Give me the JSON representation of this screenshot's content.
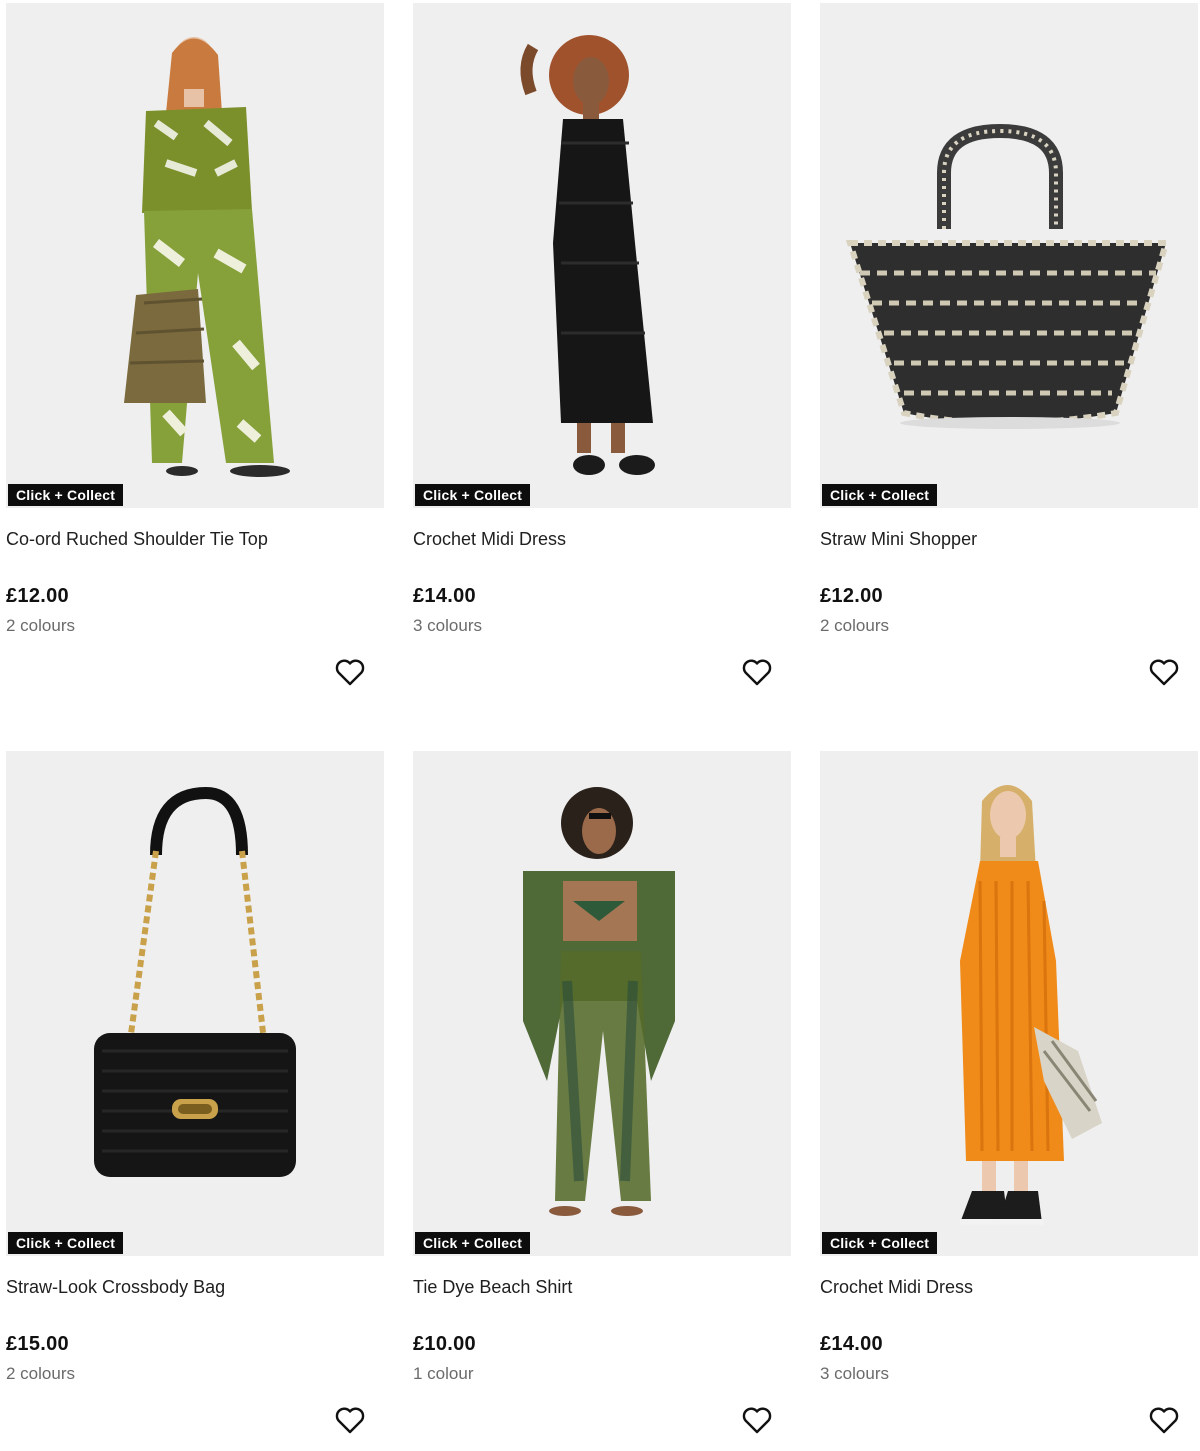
{
  "products": [
    {
      "badge": "Click + Collect",
      "title": "Co-ord Ruched Shoulder Tie Top",
      "price": "£12.00",
      "colours": "2 colours",
      "image": "woman-green-leaf-print-coord",
      "fav_icon": "heart-outline-icon"
    },
    {
      "badge": "Click + Collect",
      "title": "Crochet Midi Dress",
      "price": "£14.00",
      "colours": "3 colours",
      "image": "woman-black-crochet-dress",
      "fav_icon": "heart-outline-icon"
    },
    {
      "badge": "Click + Collect",
      "title": "Straw Mini Shopper",
      "price": "£12.00",
      "colours": "2 colours",
      "image": "black-white-straw-tote-bag",
      "fav_icon": "heart-outline-icon"
    },
    {
      "badge": "Click + Collect",
      "title": "Straw-Look Crossbody Bag",
      "price": "£15.00",
      "colours": "2 colours",
      "image": "black-straw-bag-gold-chain",
      "fav_icon": "heart-outline-icon"
    },
    {
      "badge": "Click + Collect",
      "title": "Tie Dye Beach Shirt",
      "price": "£10.00",
      "colours": "1 colour",
      "image": "woman-green-tie-dye-beach-set",
      "fav_icon": "heart-outline-icon"
    },
    {
      "badge": "Click + Collect",
      "title": "Crochet Midi Dress",
      "price": "£14.00",
      "colours": "3 colours",
      "image": "woman-orange-crochet-dress",
      "fav_icon": "heart-outline-icon"
    }
  ],
  "colors": {
    "image_bg": "#efefef",
    "badge_bg": "#0d0d0d",
    "badge_text": "#ffffff",
    "muted_text": "#6b6b6b"
  }
}
